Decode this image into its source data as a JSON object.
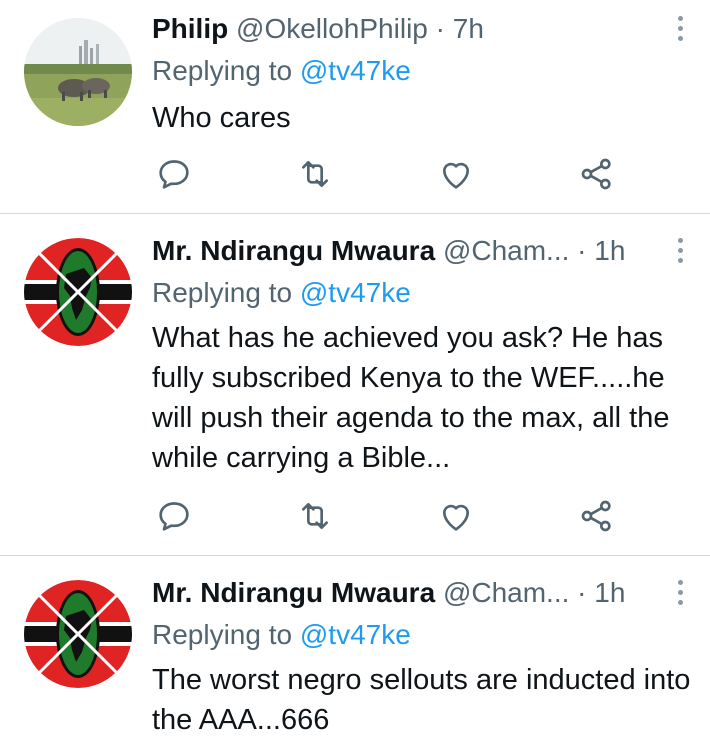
{
  "colors": {
    "text": "#0f1419",
    "secondary": "#536471",
    "link": "#1d9bf0",
    "divider": "#cfd9de"
  },
  "tweets": [
    {
      "name": "Philip",
      "handle": "@OkellohPhilip",
      "separator": "·",
      "time": "7h",
      "replying_prefix": "Replying to ",
      "replying_to": "@tv47ke",
      "text": "Who cares",
      "avatar": "rhino-landscape-avatar",
      "actions": [
        "reply-icon",
        "retweet-icon",
        "like-icon",
        "share-icon"
      ]
    },
    {
      "name": "Mr. Ndirangu Mwaura",
      "handle": "@Cham...",
      "separator": "·",
      "time": "1h",
      "replying_prefix": "Replying to ",
      "replying_to": "@tv47ke",
      "text": "What has he achieved you ask? He has fully subscribed Kenya to the WEF.....he will push their agenda to the max, all the while carrying a Bible...",
      "avatar": "kenya-africa-shield-avatar",
      "actions": [
        "reply-icon",
        "retweet-icon",
        "like-icon",
        "share-icon"
      ]
    },
    {
      "name": "Mr. Ndirangu Mwaura",
      "handle": "@Cham...",
      "separator": "·",
      "time": "1h",
      "replying_prefix": "Replying to ",
      "replying_to": "@tv47ke",
      "text": "The worst negro sellouts are inducted into the AAA...666",
      "avatar": "kenya-africa-shield-avatar"
    }
  ]
}
